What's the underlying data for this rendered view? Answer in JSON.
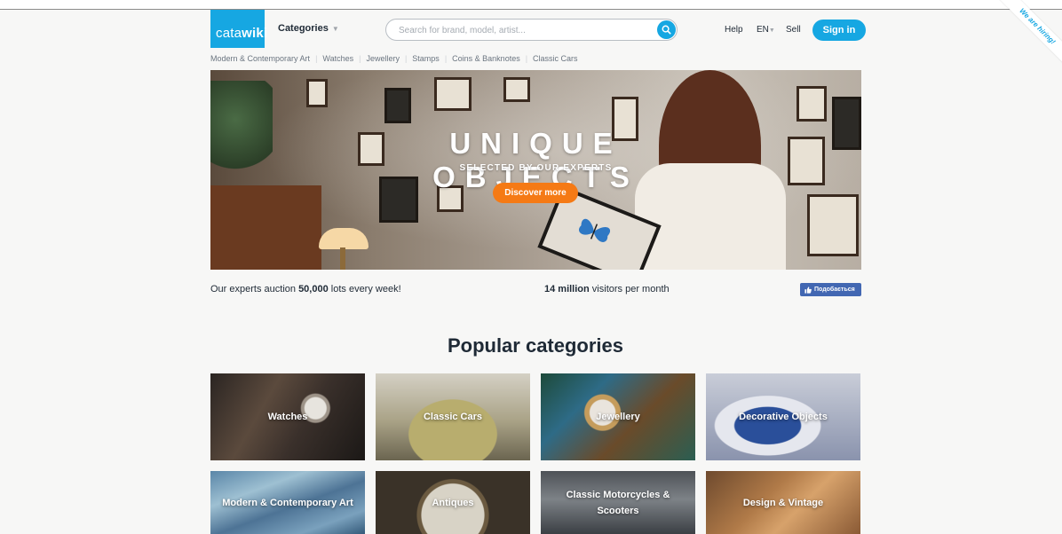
{
  "brand": {
    "logo_light": "cata",
    "logo_bold": "wiki",
    "accent": "#16a7e2",
    "cta": "#f57a15"
  },
  "header": {
    "categories_label": "Categories",
    "search_placeholder": "Search for brand, model, artist...",
    "search_value": "",
    "help": "Help",
    "language": "EN",
    "sell": "Sell",
    "sign_in": "Sign in",
    "ribbon": "We are hiring!"
  },
  "subnav": [
    "Modern & Contemporary Art",
    "Watches",
    "Jewellery",
    "Stamps",
    "Coins & Banknotes",
    "Classic Cars"
  ],
  "hero": {
    "title": "UNIQUE OBJECTS",
    "subtitle": "SELECTED BY OUR EXPERTS",
    "button": "Discover more"
  },
  "stats": {
    "left_prefix": "Our experts auction ",
    "left_bold": "50,000",
    "left_suffix": " lots every week!",
    "mid_bold": "14 million",
    "mid_suffix": " visitors per month",
    "fb_like": "Подобається"
  },
  "popular": {
    "title": "Popular categories",
    "tiles": [
      {
        "label": "Watches"
      },
      {
        "label": "Classic Cars"
      },
      {
        "label": "Jewellery"
      },
      {
        "label": "Decorative Objects"
      },
      {
        "label": "Modern & Contemporary Art"
      },
      {
        "label": "Antiques"
      },
      {
        "label": "Classic Motorcycles & Scooters"
      },
      {
        "label": "Design & Vintage"
      }
    ]
  }
}
